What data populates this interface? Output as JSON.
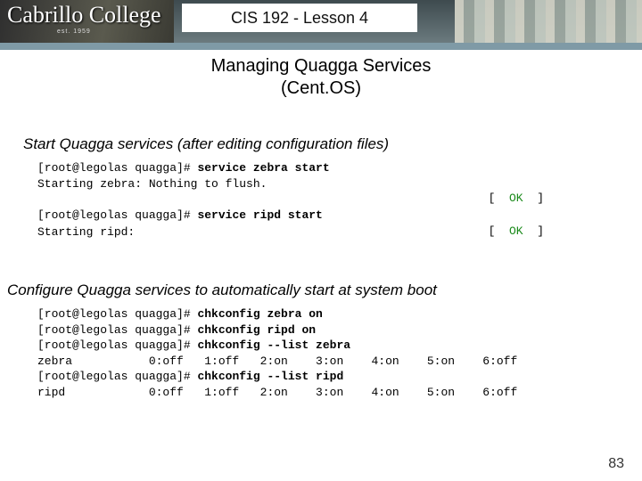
{
  "header": {
    "logo_text": "Cabrillo College",
    "est_text": "est. 1959",
    "title": "CIS 192 - Lesson 4"
  },
  "slide": {
    "title_line1": "Managing Quagga Services",
    "title_line2": "(Cent.OS)"
  },
  "section1": {
    "heading": "Start Quagga services (after editing configuration files)",
    "line1_prompt": "[root@legolas quagga]# ",
    "line1_cmd": "service zebra start",
    "line2": "Starting zebra: Nothing to flush.",
    "ok1": "[  OK  ]",
    "line3_prompt": "[root@legolas quagga]# ",
    "line3_cmd": "service ripd start",
    "line4": "Starting ripd:",
    "ok2": "[  OK  ]"
  },
  "section2": {
    "heading": "Configure Quagga services to automatically start at system boot",
    "p1_prompt": "[root@legolas quagga]# ",
    "p1_cmd": "chkconfig zebra on",
    "p2_prompt": "[root@legolas quagga]# ",
    "p2_cmd": "chkconfig ripd on",
    "p3_prompt": "[root@legolas quagga]# ",
    "p3_cmd": "chkconfig --list zebra",
    "p3_out": "zebra           0:off   1:off   2:on    3:on    4:on    5:on    6:off",
    "p4_prompt": "[root@legolas quagga]# ",
    "p4_cmd": "chkconfig --list ripd",
    "p4_out": "ripd            0:off   1:off   2:on    3:on    4:on    5:on    6:off"
  },
  "page_number": "83"
}
